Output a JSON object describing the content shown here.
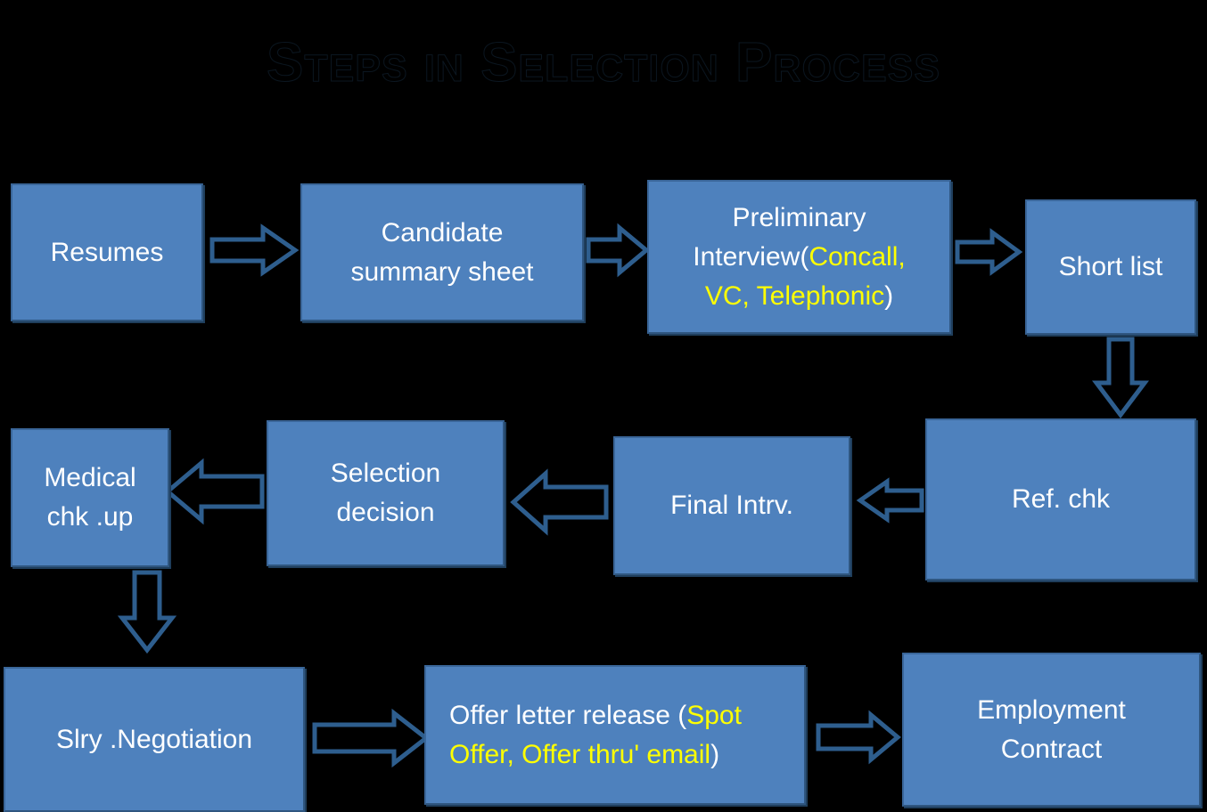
{
  "title": "Steps in Selection Process",
  "colors": {
    "background": "#000000",
    "box_fill": "#4E81BD",
    "box_border": "#3A6699",
    "box_text": "#FFFFFF",
    "highlight_text": "#FFFF00",
    "arrow_stroke": "#2E5E8E",
    "title_text": "#000000"
  },
  "diagram": {
    "type": "flowchart",
    "rows": [
      {
        "row": 1,
        "direction": "left-to-right",
        "steps": [
          "Resumes",
          "Candidate summary sheet",
          "Preliminary Interview(Concall, VC, Telephonic)",
          "Short list"
        ]
      },
      {
        "row": 2,
        "direction": "right-to-left",
        "steps": [
          "Ref. chk",
          "Final Intrv.",
          "Selection decision",
          "Medical chk .up"
        ]
      },
      {
        "row": 3,
        "direction": "left-to-right",
        "steps": [
          "Slry .Negotiation",
          "Offer letter release  (Spot Offer, Offer thru'  email)",
          "Employment Contract"
        ]
      }
    ]
  },
  "nodes": {
    "resumes": {
      "label": "Resumes"
    },
    "candidate_summary": {
      "line1": "Candidate",
      "line2": "summary sheet"
    },
    "preliminary_interview": {
      "line1": "Preliminary",
      "line2_white": "Interview(",
      "line2_yellow": "Concall,",
      "line3_yellow": "VC, Telephonic",
      "line3_white": ")"
    },
    "short_list": {
      "label": "Short list"
    },
    "ref_chk": {
      "label": "Ref. chk"
    },
    "final_intrv": {
      "label": "Final Intrv."
    },
    "selection_decision": {
      "line1": "Selection",
      "line2": "decision"
    },
    "medical_chk": {
      "line1": "Medical",
      "line2": "chk .up"
    },
    "slry_negotiation": {
      "label": "Slry .Negotiation"
    },
    "offer_letter": {
      "line1_white": "Offer letter release  (",
      "line1_yellow": "Spot",
      "line2_yellow": "Offer, Offer thru'  email",
      "line2_white": ")"
    },
    "employment_contract": {
      "line1": "Employment",
      "line2": "Contract"
    }
  },
  "connectors": [
    {
      "name": "resumes-to-candidate",
      "direction": "right"
    },
    {
      "name": "candidate-to-preliminary",
      "direction": "right"
    },
    {
      "name": "preliminary-to-shortlist",
      "direction": "right"
    },
    {
      "name": "shortlist-to-refchk",
      "direction": "down"
    },
    {
      "name": "refchk-to-finalintrv",
      "direction": "left"
    },
    {
      "name": "finalintrv-to-selection",
      "direction": "left"
    },
    {
      "name": "selection-to-medical",
      "direction": "left"
    },
    {
      "name": "medical-to-slry",
      "direction": "down"
    },
    {
      "name": "slry-to-offer",
      "direction": "right"
    },
    {
      "name": "offer-to-employment",
      "direction": "right"
    }
  ]
}
